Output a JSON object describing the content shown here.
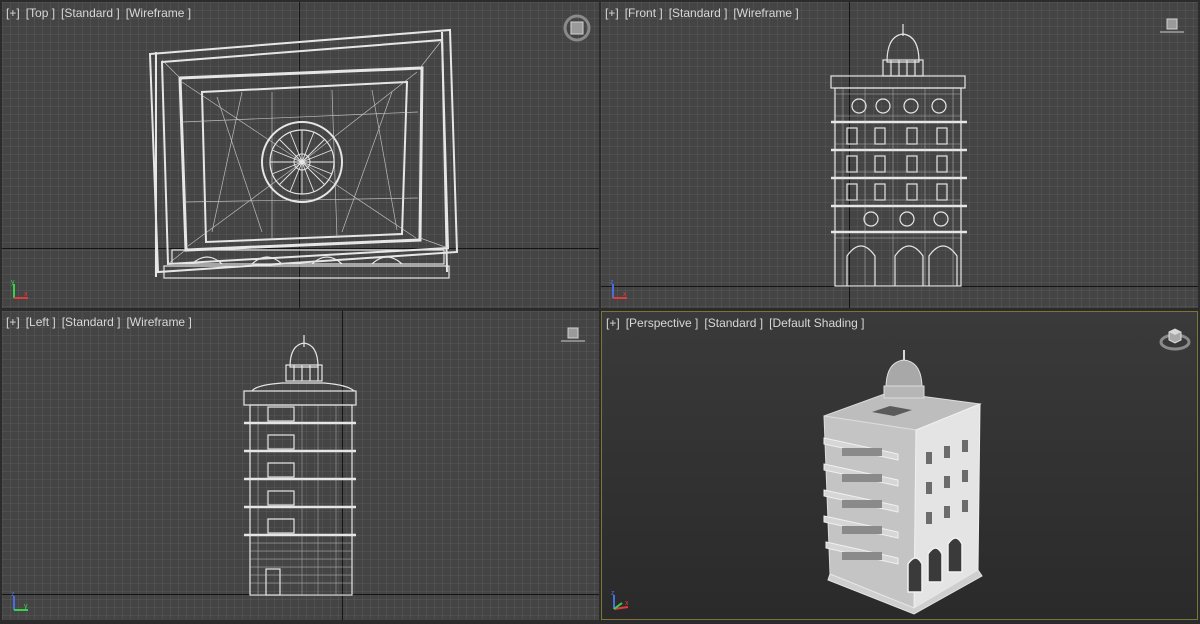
{
  "viewports": {
    "top": {
      "menu": "[+]",
      "view": "[Top ]",
      "mode": "[Standard ]",
      "shading": "[Wireframe ]"
    },
    "front": {
      "menu": "[+]",
      "view": "[Front ]",
      "mode": "[Standard ]",
      "shading": "[Wireframe ]"
    },
    "left": {
      "menu": "[+]",
      "view": "[Left ]",
      "mode": "[Standard ]",
      "shading": "[Wireframe ]"
    },
    "perspective": {
      "menu": "[+]",
      "view": "[Perspective ]",
      "mode": "[Standard ]",
      "shading": "[Default Shading ]"
    }
  },
  "icons": {
    "top_nav": "viewcube-top-icon",
    "ortho_nav": "viewcube-ortho-icon",
    "persp_nav": "viewcube-perspective-icon",
    "axis_gizmo": "axis-tripod-icon"
  },
  "colors": {
    "active_border": "#7c7438",
    "axis_x": "#e03b3b",
    "axis_y": "#3bd04a",
    "axis_z": "#4a6de0",
    "wire": "#e6e6e6"
  }
}
